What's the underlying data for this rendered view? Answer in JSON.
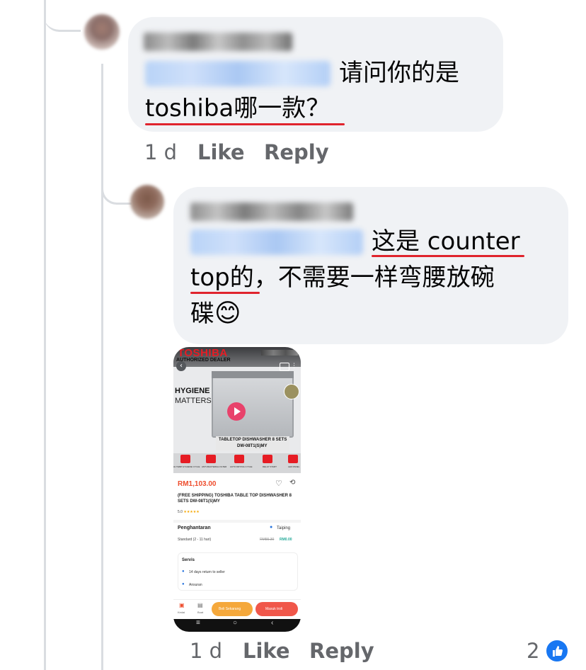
{
  "comment1": {
    "text_line1": "请问你的是",
    "text_line2": "toshiba哪一款？",
    "time": "1 d",
    "like_label": "Like",
    "reply_label": "Reply"
  },
  "comment2": {
    "text_line1": "这是 counter",
    "text_line2": "top的，不需要一样弯腰放碗",
    "text_line3": "碟",
    "emoji": "😊",
    "time": "1 d",
    "like_label": "Like",
    "reply_label": "Reply",
    "reaction_count": "2"
  },
  "attachment": {
    "brand": "TOSHIBA",
    "dealer": "AUTHORIZED DEALER",
    "tagline1": "HYGIENE",
    "tagline2": "MATTERS",
    "product_label1": "TABLETOP DISHWASHER 8 SETS",
    "product_label2": "DW-08T1(S)MY",
    "features": [
      "HI-TEMP HYGIENE CYCLE",
      "ANTI-BACTERIAL FILTER",
      "AUTO DRYING CYCLE",
      "DELAY START",
      "LED PANEL"
    ],
    "price": "RM1,103.00",
    "title": "(FREE SHIPPING) TOSHIBA TABLE TOP DISHWASHER 8 SETS DW-08T1(S)MY",
    "rating": "5.0",
    "delivery_label": "Penghantaran",
    "location": "Taiping",
    "shipping_type": "Standard (2 - 11 hari)",
    "shipping_old": "RM55.30",
    "shipping_new": "RM0.00",
    "service_label": "Servis",
    "service1": "14 days return to seller",
    "service2": "Ansuran",
    "tab1": "Kedai",
    "tab2": "Buat",
    "buy_now": "Beli Sekarang",
    "add_cart": "Masuk troli",
    "accent_color": "#ee4d2d"
  },
  "colors": {
    "bubble": "#f0f2f5",
    "meta": "#65676b",
    "like_blue": "#1877f2",
    "spell_underline": "#e0242d"
  }
}
